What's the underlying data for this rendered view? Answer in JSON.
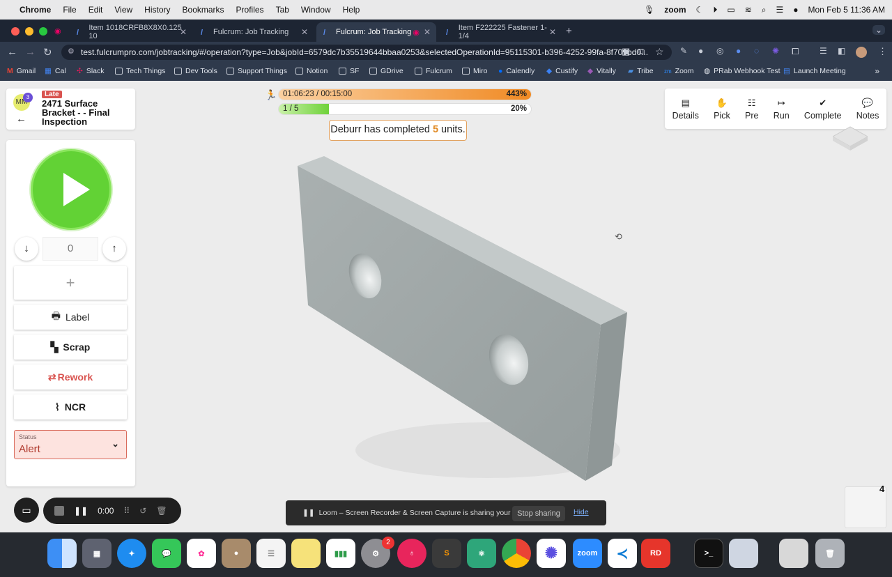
{
  "menubar": {
    "app_name": "Chrome",
    "items": [
      "File",
      "Edit",
      "View",
      "History",
      "Bookmarks",
      "Profiles",
      "Tab",
      "Window",
      "Help"
    ],
    "zoom_label": "zoom",
    "datetime": "Mon Feb 5  11:36 AM"
  },
  "tabs": [
    {
      "title": "Item 1018CRFB8X8X0.125 10"
    },
    {
      "title": "Fulcrum: Job Tracking"
    },
    {
      "title": "Fulcrum: Job Tracking"
    },
    {
      "title": "Item F222225 Fastener 1-1/4"
    }
  ],
  "url": "test.fulcrumpro.com/jobtracking/#/operation?type=Job&jobId=6579dc7b35519644bbaa0253&selectedOperationId=95115301-b396-4252-99fa-8f709bd0...",
  "bookmarks": [
    "Gmail",
    "Cal",
    "Slack",
    "Tech Things",
    "Dev Tools",
    "Support Things",
    "Notion",
    "SF",
    "GDrive",
    "Fulcrum",
    "Miro",
    "Calendly",
    "Custify",
    "Vitally",
    "Tribe",
    "Zoom",
    "PRab Webhook Test",
    "Launch Meeting"
  ],
  "job": {
    "avatar_initials": "MM",
    "avatar_badge": "3",
    "late_label": "Late",
    "title": "2471 Surface Bracket - - Final Inspection"
  },
  "progress": {
    "time_text": "01:06:23 / 00:15:00",
    "time_percent_text": "443%",
    "units_text": "1 / 5",
    "units_percent_text": "20%",
    "units_fraction": 0.2
  },
  "toast": {
    "prefix": "Deburr has completed ",
    "count": "5",
    "suffix": " units."
  },
  "toolbar": {
    "details": "Details",
    "pick": "Pick",
    "pre": "Pre",
    "run": "Run",
    "complete": "Complete",
    "notes": "Notes"
  },
  "controls": {
    "quantity": "0",
    "add_label": "+",
    "label_btn": "Label",
    "scrap_btn": "Scrap",
    "rework_btn": "Rework",
    "ncr_btn": "NCR",
    "status_label": "Status",
    "status_value": "Alert"
  },
  "recorder": {
    "time": "0:00"
  },
  "loom": {
    "message": "Loom – Screen Recorder & Screen Capture is sharing your screen.",
    "stop": "Stop sharing",
    "hide": "Hide"
  },
  "mini_count": "4",
  "dock": {
    "settings_badge": "2",
    "zoom_label": "zoom",
    "rd_label": "RD"
  },
  "colors": {
    "late": "#d9534f",
    "play": "#62d235",
    "time_bar": "#f08a24",
    "units_bar": "#6fd23a",
    "alert": "#b03a2e"
  }
}
